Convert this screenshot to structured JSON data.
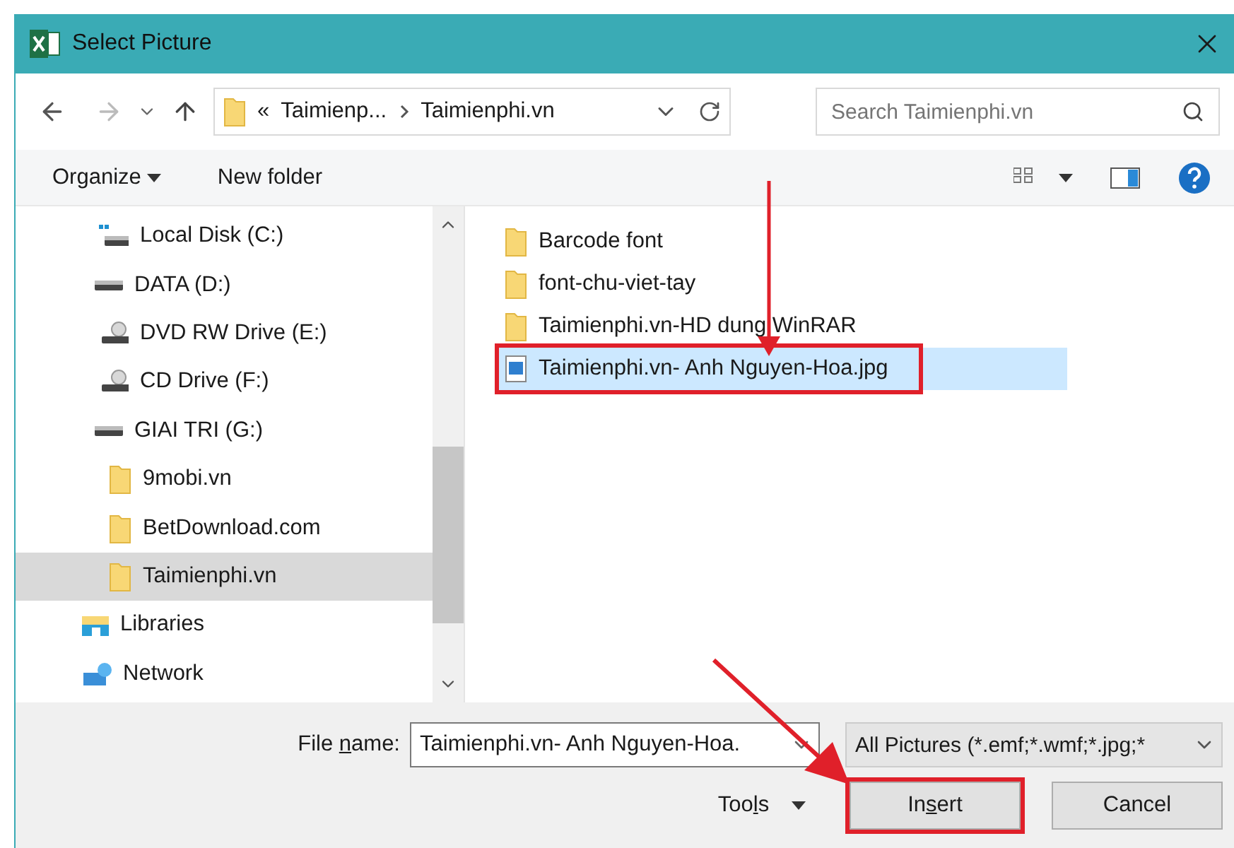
{
  "window": {
    "title": "Select Picture"
  },
  "address_bar": {
    "overflow": "«",
    "path": [
      {
        "label": "Taimienp..."
      },
      {
        "label": "Taimienphi.vn"
      }
    ]
  },
  "search": {
    "placeholder": "Search Taimienphi.vn"
  },
  "toolbar": {
    "organize": "Organize",
    "new_folder": "New folder"
  },
  "sidebar": {
    "drives": [
      {
        "label": "Local Disk (C:)",
        "kind": "system-disk",
        "selected": false
      },
      {
        "label": "DATA (D:)",
        "kind": "disk",
        "selected": false
      },
      {
        "label": "DVD RW Drive (E:)",
        "kind": "optical",
        "selected": false
      },
      {
        "label": "CD Drive (F:)",
        "kind": "optical",
        "selected": false
      },
      {
        "label": "GIAI TRI (G:)",
        "kind": "disk",
        "selected": false,
        "children": [
          {
            "label": "9mobi.vn",
            "kind": "folder",
            "selected": false
          },
          {
            "label": "BetDownload.com",
            "kind": "folder",
            "selected": false
          },
          {
            "label": "Taimienphi.vn",
            "kind": "folder",
            "selected": true
          }
        ]
      }
    ],
    "places": [
      {
        "label": "Libraries",
        "kind": "libraries",
        "selected": false
      },
      {
        "label": "Network",
        "kind": "network",
        "selected": false
      }
    ]
  },
  "files": [
    {
      "name": "Barcode font",
      "kind": "folder",
      "selected": false,
      "highlighted": false
    },
    {
      "name": "font-chu-viet-tay",
      "kind": "folder",
      "selected": false,
      "highlighted": false
    },
    {
      "name": "Taimienphi.vn-HD dung WinRAR",
      "kind": "folder",
      "selected": false,
      "highlighted": false
    },
    {
      "name": "Taimienphi.vn- Anh Nguyen-Hoa.jpg",
      "kind": "image",
      "selected": true,
      "highlighted": true
    }
  ],
  "file_name": {
    "label_parts": [
      "File ",
      "n",
      "ame:"
    ],
    "value": "Taimienphi.vn- Anh Nguyen-Hoa."
  },
  "file_type": {
    "value": "All Pictures (*.emf;*.wmf;*.jpg;*"
  },
  "buttons": [
    {
      "kind": "menu",
      "parts": [
        "Too",
        "l",
        "s"
      ],
      "highlighted": false
    },
    {
      "kind": "primary",
      "parts": [
        "In",
        "s",
        "ert"
      ],
      "highlighted": true
    },
    {
      "kind": "plain",
      "parts": [
        "Cancel"
      ],
      "highlighted": false
    }
  ]
}
